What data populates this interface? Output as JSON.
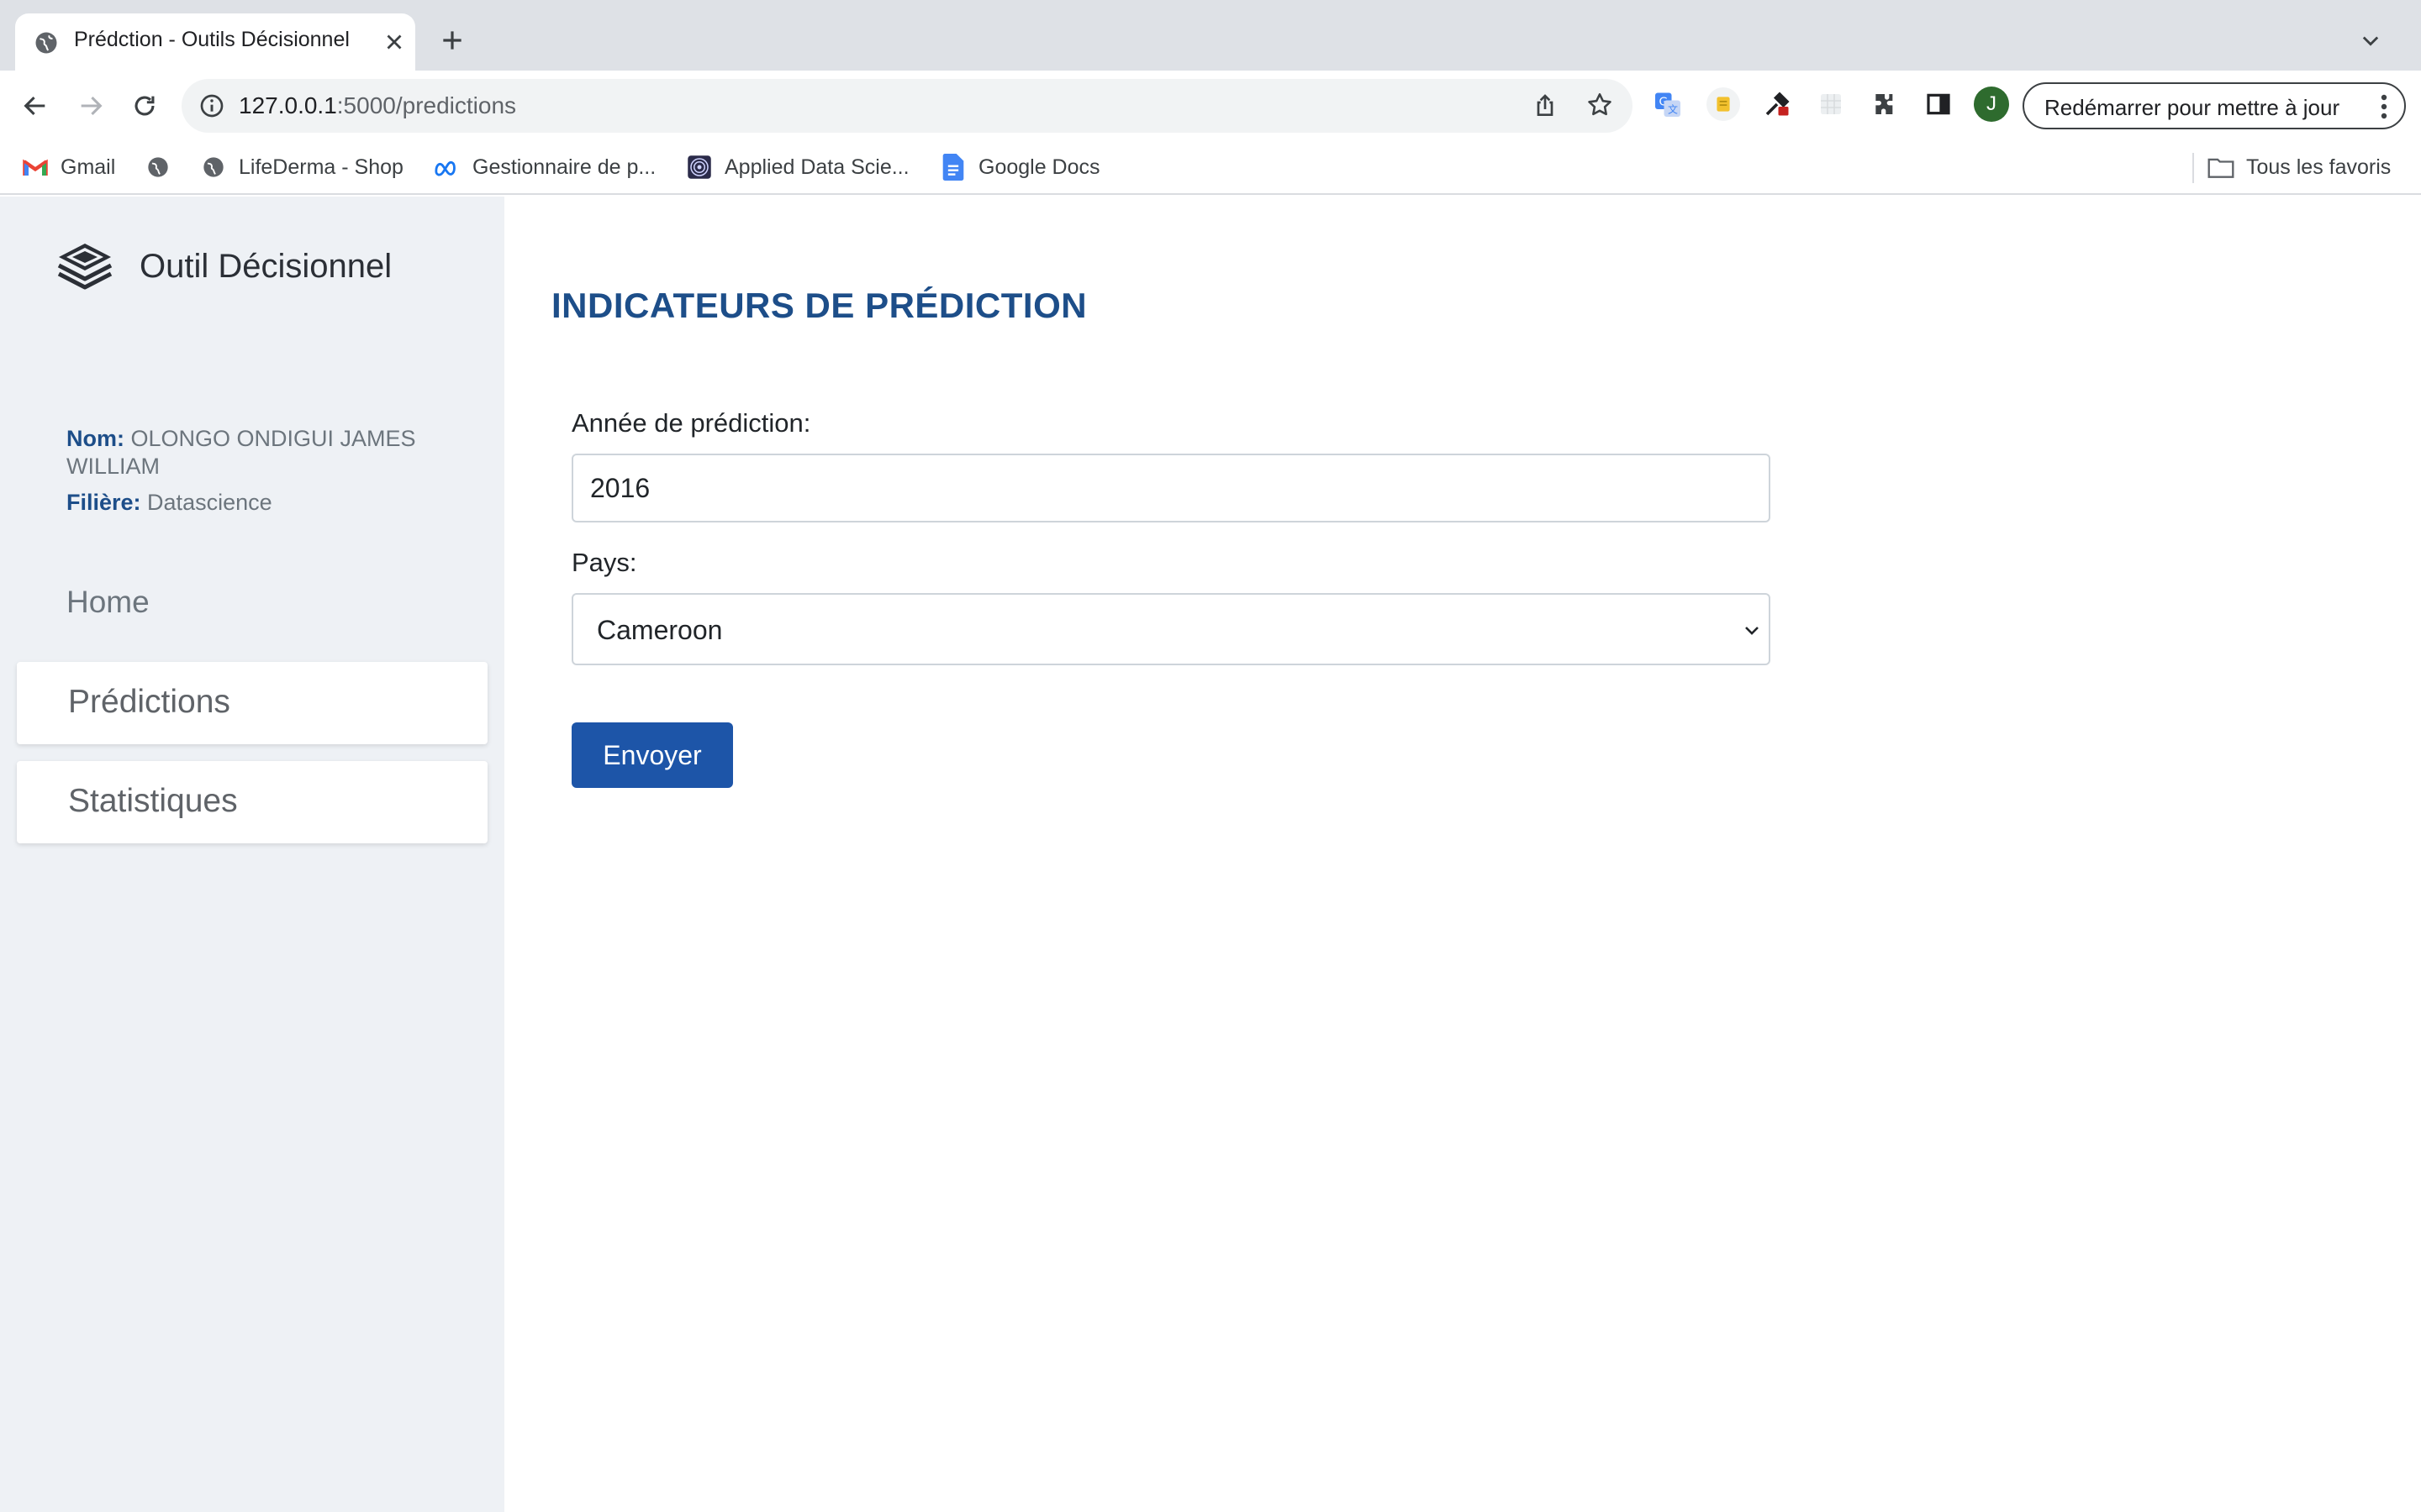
{
  "browser": {
    "tab_title": "Prédction - Outils Décisionnel",
    "url_host": "127.0.0.1",
    "url_path": ":5000/predictions",
    "avatar_letter": "J",
    "update_label": "Redémarrer pour mettre à jour",
    "accent_avatar": "#2e6b2e"
  },
  "bookmarks": {
    "items": [
      {
        "label": "Gmail",
        "icon": "gmail-icon"
      },
      {
        "label": "",
        "icon": "globe-icon"
      },
      {
        "label": "LifeDerma - Shop",
        "icon": "globe-icon"
      },
      {
        "label": "Gestionnaire de p...",
        "icon": "meta-icon"
      },
      {
        "label": "Applied Data Scie...",
        "icon": "spiral-icon"
      },
      {
        "label": "Google Docs",
        "icon": "docs-icon"
      }
    ],
    "all_label": "Tous les favoris"
  },
  "sidebar": {
    "brand": "Outil Décisionnel",
    "name_key": "Nom:",
    "name_value": "OLONGO ONDIGUI JAMES WILLIAM",
    "field_key": "Filière:",
    "field_value": "Datascience",
    "nav": {
      "home": "Home",
      "predictions": "Prédictions",
      "stats": "Statistiques"
    }
  },
  "main": {
    "title": "INDICATEURS DE PRÉDICTION",
    "year_label": "Année de prédiction:",
    "year_value": "2016",
    "country_label": "Pays:",
    "country_value": "Cameroon",
    "submit_label": "Envoyer",
    "accent": "#1d55a8",
    "title_color": "#1d4e89"
  }
}
